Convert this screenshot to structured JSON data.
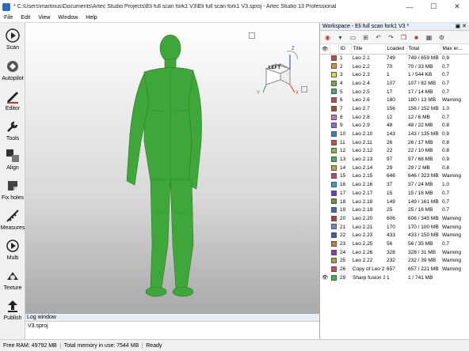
{
  "window": {
    "title": "* C:\\Users\\martinus\\Documents\\Artec Studio Projects\\Eli full scan fork1 V3\\Eli full scan fork1 V3.sproj - Artec Studio 13 Professional",
    "minimize": "—",
    "maximize": "☐",
    "close": "✕"
  },
  "menu": [
    "File",
    "Edit",
    "View",
    "Window",
    "Help"
  ],
  "tools": [
    "Scan",
    "Autopilot",
    "Editor",
    "Tools",
    "Align",
    "Fix holes",
    "Measures",
    "Multi",
    "Texture",
    "Publish"
  ],
  "viewcube": {
    "face": "LEFT",
    "axis_x": "X",
    "axis_y": "Y",
    "axis_z": "Z"
  },
  "log": {
    "title": "Log window",
    "text": "V3.sproj"
  },
  "workspace": {
    "title": "Workspace - Eli full scan fork1 V3 *",
    "columns": [
      "ID",
      "Title",
      "Loaded",
      "Total",
      "Max er..."
    ],
    "rows": [
      {
        "eye": "",
        "color": "#c94a4a",
        "id": "1",
        "title": "Leo 2.1",
        "loaded": "749",
        "total": "749 / 659 MB",
        "max": "0.9"
      },
      {
        "eye": "",
        "color": "#e08a3a",
        "id": "2",
        "title": "Leo 2.2",
        "loaded": "70",
        "total": "70 / 33 MB",
        "max": "0.7"
      },
      {
        "eye": "",
        "color": "#e6d84a",
        "id": "3",
        "title": "Leo 2.3",
        "loaded": "1",
        "total": "1 / 544 KB",
        "max": "0.7"
      },
      {
        "eye": "",
        "color": "#7aa83a",
        "id": "4",
        "title": "Leo 2.4",
        "loaded": "107",
        "total": "107 / 82 MB",
        "max": "0.7"
      },
      {
        "eye": "",
        "color": "#3ab08a",
        "id": "5",
        "title": "Leo 2.5",
        "loaded": "17",
        "total": "17 / 14 MB",
        "max": "0.7"
      },
      {
        "eye": "",
        "color": "#c94a4a",
        "id": "6",
        "title": "Leo 2.6",
        "loaded": "180",
        "total": "180 / 13 MB",
        "max": "Warning"
      },
      {
        "eye": "",
        "color": "#a0522d",
        "id": "7",
        "title": "Leo 2.7",
        "loaded": "156",
        "total": "156 / 152 MB",
        "max": "1.0"
      },
      {
        "eye": "",
        "color": "#c878c8",
        "id": "8",
        "title": "Leo 2.8",
        "loaded": "12",
        "total": "12 / 6 MB",
        "max": "0.7"
      },
      {
        "eye": "",
        "color": "#8a6ad0",
        "id": "9",
        "title": "Leo 2.9",
        "loaded": "48",
        "total": "48 / 22 MB",
        "max": "0.8"
      },
      {
        "eye": "",
        "color": "#3a7ad0",
        "id": "10",
        "title": "Leo 2.10",
        "loaded": "143",
        "total": "143 / 135 MB",
        "max": "0.9"
      },
      {
        "eye": "",
        "color": "#d04a4a",
        "id": "11",
        "title": "Leo 2.11",
        "loaded": "26",
        "total": "26 / 17 MB",
        "max": "0.8"
      },
      {
        "eye": "",
        "color": "#8ab83a",
        "id": "12",
        "title": "Leo 2.12",
        "loaded": "22",
        "total": "22 / 10 MB",
        "max": "0.8"
      },
      {
        "eye": "",
        "color": "#3ab84a",
        "id": "13",
        "title": "Leo 2.13",
        "loaded": "97",
        "total": "97 / 68 MB",
        "max": "0.9"
      },
      {
        "eye": "",
        "color": "#b8a83a",
        "id": "14",
        "title": "Leo 2.14",
        "loaded": "29",
        "total": "29 / 2 MB",
        "max": "0.8"
      },
      {
        "eye": "",
        "color": "#c83a8a",
        "id": "15",
        "title": "Leo 2.15",
        "loaded": "646",
        "total": "646 / 323 MB",
        "max": "Warning"
      },
      {
        "eye": "",
        "color": "#3a9ad0",
        "id": "16",
        "title": "Leo 2.16",
        "loaded": "37",
        "total": "37 / 24 MB",
        "max": "1.0"
      },
      {
        "eye": "",
        "color": "#6a3ad0",
        "id": "17",
        "title": "Leo 2.17",
        "loaded": "15",
        "total": "15 / 16 MB",
        "max": "0.7"
      },
      {
        "eye": "",
        "color": "#8a8a3a",
        "id": "18",
        "title": "Leo 2.18",
        "loaded": "149",
        "total": "149 / 161 MB",
        "max": "0.7"
      },
      {
        "eye": "",
        "color": "#3a6ab8",
        "id": "19",
        "title": "Leo 2.19",
        "loaded": "25",
        "total": "25 / 16 MB",
        "max": "0.7"
      },
      {
        "eye": "",
        "color": "#b83a3a",
        "id": "20",
        "title": "Leo 2.20",
        "loaded": "606",
        "total": "606 / 345 MB",
        "max": "Warning"
      },
      {
        "eye": "",
        "color": "#6a8ad0",
        "id": "21",
        "title": "Leo 2.21",
        "loaded": "170",
        "total": "170 / 100 MB",
        "max": "Warning"
      },
      {
        "eye": "",
        "color": "#3a5ab8",
        "id": "22",
        "title": "Leo 2.23",
        "loaded": "433",
        "total": "433 / 150 MB",
        "max": "Warning"
      },
      {
        "eye": "",
        "color": "#d07a3a",
        "id": "23",
        "title": "Leo 2.25",
        "loaded": "56",
        "total": "56 / 35 MB",
        "max": "0.7"
      },
      {
        "eye": "",
        "color": "#8a3ab8",
        "id": "24",
        "title": "Leo 2.26",
        "loaded": "328",
        "total": "328 / 31 MB",
        "max": "Warning"
      },
      {
        "eye": "",
        "color": "#b89a3a",
        "id": "25",
        "title": "Leo 2.22",
        "loaded": "232",
        "total": "232 / 39 MB",
        "max": "Warning"
      },
      {
        "eye": "",
        "color": "#c84a6a",
        "id": "26",
        "title": "Copy of Leo 2.2",
        "loaded": "657",
        "total": "657 / 221 MB",
        "max": "Warning"
      },
      {
        "eye": "👁",
        "color": "#3ab84a",
        "id": "29",
        "title": "Sharp fusion 3",
        "loaded": "1",
        "total": "1 / 741 MB",
        "max": ""
      }
    ]
  },
  "status": {
    "free_ram": "Free RAM: 49792 MB",
    "total_memory": "Total memory in use: 7544 MB",
    "state": "Ready"
  },
  "colors": {
    "model": "#3fa63a",
    "accent": "#2b6cc4"
  }
}
